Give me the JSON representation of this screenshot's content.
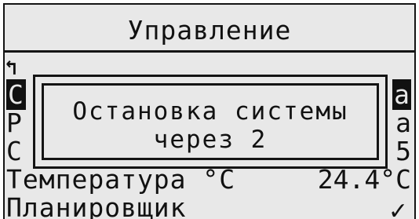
{
  "screen": {
    "title": "Управление",
    "back_symbol": "↰",
    "rows": [
      {
        "left": "С",
        "right": "а"
      },
      {
        "left": "Р",
        "right": "а"
      },
      {
        "left": "С",
        "right": "5"
      },
      {
        "left": "Температура °C",
        "right": "24.4°C"
      },
      {
        "left": "Планировщик",
        "right": "✓"
      }
    ]
  },
  "popup": {
    "line1": "Остановка системы",
    "line2": "через 2"
  }
}
